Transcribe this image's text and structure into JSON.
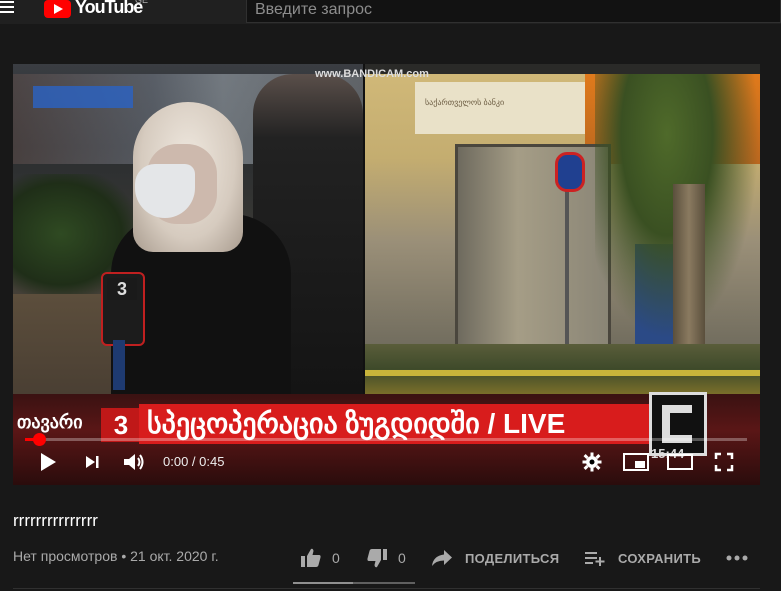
{
  "header": {
    "logo_text": "YouTube",
    "country_code": "GE",
    "search_placeholder": "Введите запрос"
  },
  "player": {
    "watermark": "www.BANDICAM.com",
    "bank_sign": "საქართველოს ბანკი",
    "mic_logo": "3",
    "lower_third": {
      "channel_name": "თავარი",
      "channel_number": "3",
      "headline": "სპეცოპერაცია ზუგდიდში / LIVE",
      "clock": "15:44"
    },
    "time_display": "0:00 / 0:45",
    "progress_fraction": 0.0
  },
  "video": {
    "title": "rrrrrrrrrrrrrrr",
    "views": "Нет просмотров",
    "date": "21 окт. 2020 г.",
    "likes": "0",
    "dislikes": "0",
    "share_label": "ПОДЕЛИТЬСЯ",
    "save_label": "СОХРАНИТЬ"
  },
  "colors": {
    "accent": "#ff0000",
    "background": "#181818",
    "text_secondary": "#aaaaaa"
  }
}
